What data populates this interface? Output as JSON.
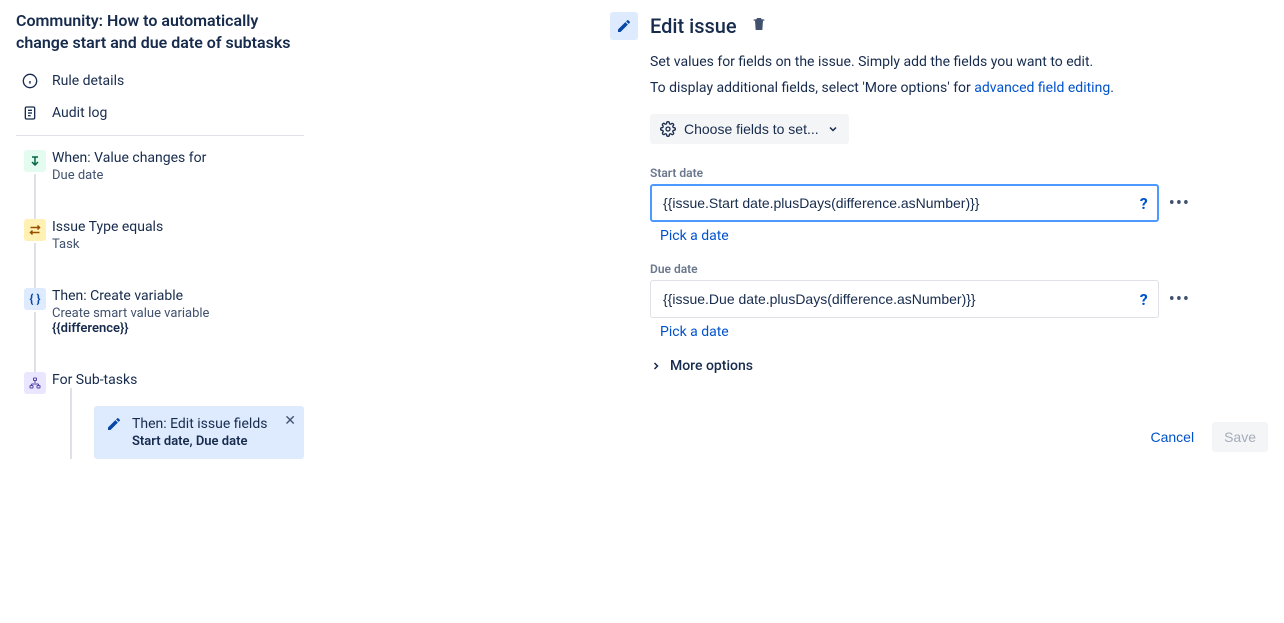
{
  "sidebar": {
    "title": "Community: How to automatically change start and due date of subtasks",
    "nav": {
      "rule_details": "Rule details",
      "audit_log": "Audit log"
    },
    "steps": {
      "trigger": {
        "title": "When: Value changes for",
        "sub": "Due date"
      },
      "condition": {
        "title": "Issue Type equals",
        "sub": "Task"
      },
      "variable": {
        "title": "Then: Create variable",
        "sub": "Create smart value variable",
        "var": "{{difference}}"
      },
      "branch": {
        "title": "For Sub-tasks"
      },
      "child": {
        "title": "Then: Edit issue fields",
        "sub": "Start date, Due date"
      }
    }
  },
  "panel": {
    "title": "Edit issue",
    "desc": "Set values for fields on the issue. Simply add the fields you want to edit.",
    "desc2_pre": "To display additional fields, select 'More options' for ",
    "desc2_link": "advanced field editing",
    "choose_label": "Choose fields to set...",
    "fields": {
      "start": {
        "label": "Start date",
        "value": "{{issue.Start date.plusDays(difference.asNumber)}}",
        "pick": "Pick a date"
      },
      "due": {
        "label": "Due date",
        "value": "{{issue.Due date.plusDays(difference.asNumber)}}",
        "pick": "Pick a date"
      }
    },
    "more_options": "More options",
    "cancel": "Cancel",
    "save": "Save"
  }
}
